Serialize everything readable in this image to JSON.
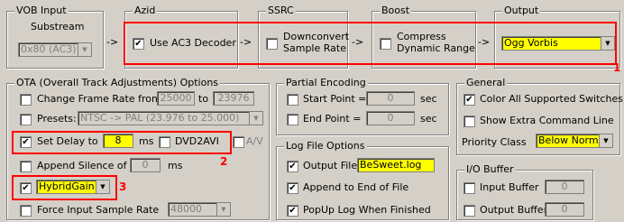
{
  "vob": {
    "title": "VOB Input",
    "substream_label": "Substream",
    "substream_value": "0x80 (AC3)"
  },
  "arrow": "->",
  "azid": {
    "title": "Azid",
    "use_ac3": "Use AC3 Decoder",
    "checked": "✔"
  },
  "ssrc": {
    "title": "SSRC",
    "label1": "Downconvert",
    "label2": "Sample Rate"
  },
  "boost": {
    "title": "Boost",
    "label1": "Compress",
    "label2": "Dynamic Range"
  },
  "output": {
    "title": "Output",
    "value": "Ogg Vorbis"
  },
  "ota": {
    "title": "OTA (Overall Track Adjustments) Options",
    "change_rate": "Change Frame Rate from",
    "rate_from": "25000",
    "rate_to_label": "to",
    "rate_to": "23976",
    "presets": "Presets:",
    "presets_value": "NTSC -> PAL   (23.976 to 25.000)",
    "set_delay": "Set Delay to",
    "delay_value": "8",
    "delay_unit": "ms",
    "dvd2avi": "DVD2AVI",
    "av": "A/V",
    "append_silence": "Append Silence of",
    "silence_value": "0",
    "silence_unit": "ms",
    "hybrid": "HybridGain",
    "force_rate": "Force Input Sample Rate",
    "force_value": "48000"
  },
  "partial": {
    "title": "Partial Encoding",
    "start": "Start Point =",
    "start_value": "0",
    "start_unit": "sec",
    "end": "End Point =",
    "end_value": "0",
    "end_unit": "sec"
  },
  "log": {
    "title": "Log File Options",
    "output_file": "Output File",
    "file_value": "BeSweet.log",
    "append": "Append to End of File",
    "popup": "PopUp Log When Finished"
  },
  "general": {
    "title": "General",
    "color_all": "Color All Supported Switches",
    "extra_cmd": "Show Extra Command Line",
    "priority_label": "Priority Class",
    "priority_value": "Below Normal"
  },
  "io": {
    "title": "I/O Buffer",
    "input": "Input Buffer",
    "input_value": "0",
    "output": "Output Buffer",
    "output_value": "0"
  },
  "markers": {
    "m1": "1",
    "m2": "2",
    "m3": "3"
  },
  "glyphs": {
    "dropdown": "▼"
  },
  "colors": {
    "highlight_yellow": "#ffff00",
    "annotation_red": "#ff0000"
  }
}
